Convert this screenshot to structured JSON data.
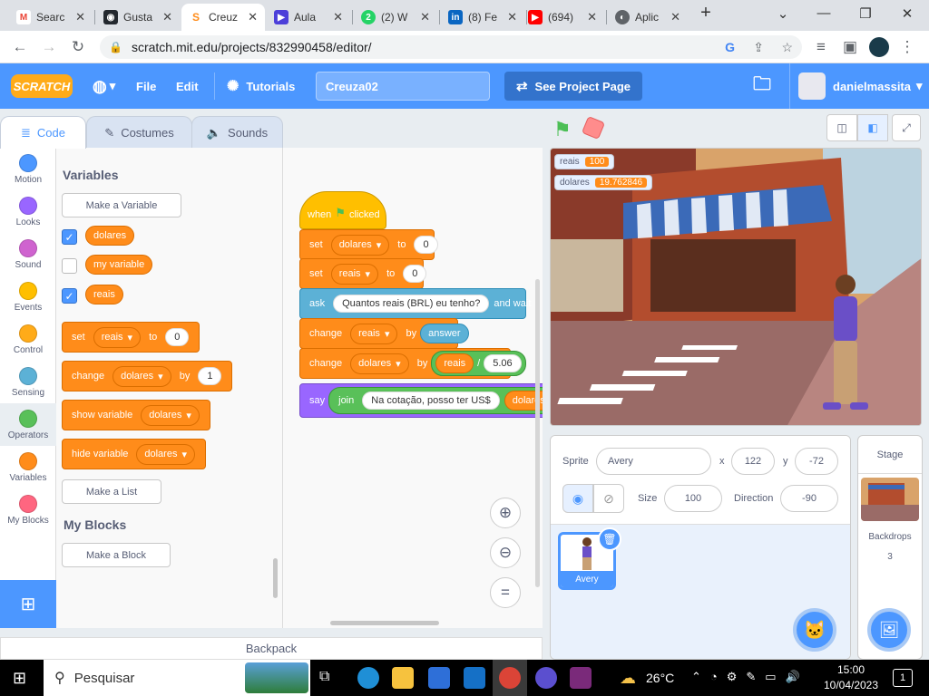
{
  "browser": {
    "tabs": [
      {
        "title": "Searc",
        "icon": "M",
        "color": "#ea4335"
      },
      {
        "title": "Gusta",
        "icon": "gh",
        "color": "#24292f"
      },
      {
        "title": "Creuz",
        "icon": "S",
        "color": "#ff8c1a"
      },
      {
        "title": "Aula ",
        "icon": "▶",
        "color": "#4c3fd9"
      },
      {
        "title": "(2) W",
        "icon": "2",
        "color": "#25d366"
      },
      {
        "title": "(8) Fe",
        "icon": "in",
        "color": "#0a66c2"
      },
      {
        "title": "(694)",
        "icon": "▶",
        "color": "#ff0000"
      },
      {
        "title": "Aplic",
        "icon": "◐",
        "color": "#5f6368"
      }
    ],
    "new_tab": "+",
    "url": "scratch.mit.edu/projects/832990458/editor/"
  },
  "menu": {
    "logo": "SCRATCH",
    "file": "File",
    "edit": "Edit",
    "tutorials": "Tutorials",
    "project_title": "Creuza02",
    "see_project": "See Project Page",
    "username": "danielmassita"
  },
  "editor_tabs": {
    "code": "Code",
    "costumes": "Costumes",
    "sounds": "Sounds"
  },
  "categories": [
    {
      "label": "Motion",
      "color": "#4c97ff"
    },
    {
      "label": "Looks",
      "color": "#9966ff"
    },
    {
      "label": "Sound",
      "color": "#cf63cf"
    },
    {
      "label": "Events",
      "color": "#ffbf00"
    },
    {
      "label": "Control",
      "color": "#ffab19"
    },
    {
      "label": "Sensing",
      "color": "#5cb1d6"
    },
    {
      "label": "Operators",
      "color": "#59c059"
    },
    {
      "label": "Variables",
      "color": "#ff8c1a"
    },
    {
      "label": "My Blocks",
      "color": "#ff6680"
    }
  ],
  "palette": {
    "variables_heading": "Variables",
    "make_variable": "Make a Variable",
    "vars": [
      {
        "name": "dolares",
        "checked": true
      },
      {
        "name": "my variable",
        "checked": false
      },
      {
        "name": "reais",
        "checked": true
      }
    ],
    "set_block": {
      "op": "set",
      "var": "reais",
      "to": "to",
      "value": "0"
    },
    "change_block": {
      "op": "change",
      "var": "dolares",
      "by": "by",
      "value": "1"
    },
    "show_block": {
      "op": "show variable",
      "var": "dolares"
    },
    "hide_block": {
      "op": "hide variable",
      "var": "dolares"
    },
    "make_list": "Make a List",
    "myblocks_heading": "My Blocks",
    "make_block": "Make a Block"
  },
  "script": {
    "hat": {
      "when": "when",
      "clicked": "clicked"
    },
    "set1": {
      "op": "set",
      "var": "dolares",
      "to": "to",
      "value": "0"
    },
    "set2": {
      "op": "set",
      "var": "reais",
      "to": "to",
      "value": "0"
    },
    "ask": {
      "op": "ask",
      "text": "Quantos reais (BRL) eu tenho?",
      "wait": "and wait"
    },
    "change1": {
      "op": "change",
      "var": "reais",
      "by": "by",
      "value": "answer"
    },
    "change2": {
      "op": "change",
      "var": "dolares",
      "by": "by",
      "left": "reais",
      "operator": "/",
      "right": "5.06"
    },
    "say": {
      "op": "say",
      "join": "join",
      "text": "Na cotação, posso ter US$",
      "var": "dolares"
    }
  },
  "backpack": "Backpack",
  "stage": {
    "monitors": [
      {
        "name": "reais",
        "value": "100"
      },
      {
        "name": "dolares",
        "value": "19.762846"
      }
    ]
  },
  "sprite_info": {
    "sprite_label": "Sprite",
    "sprite_name": "Avery",
    "x_label": "x",
    "x": "122",
    "y_label": "y",
    "y": "-72",
    "size_label": "Size",
    "size": "100",
    "direction_label": "Direction",
    "direction": "-90",
    "thumb_name": "Avery"
  },
  "stage_pane": {
    "title": "Stage",
    "backdrops_label": "Backdrops",
    "backdrops_count": "3"
  },
  "taskbar": {
    "search": "Pesquisar",
    "temperature": "26°C",
    "time": "15:00",
    "date": "10/04/2023",
    "notif": "1"
  }
}
